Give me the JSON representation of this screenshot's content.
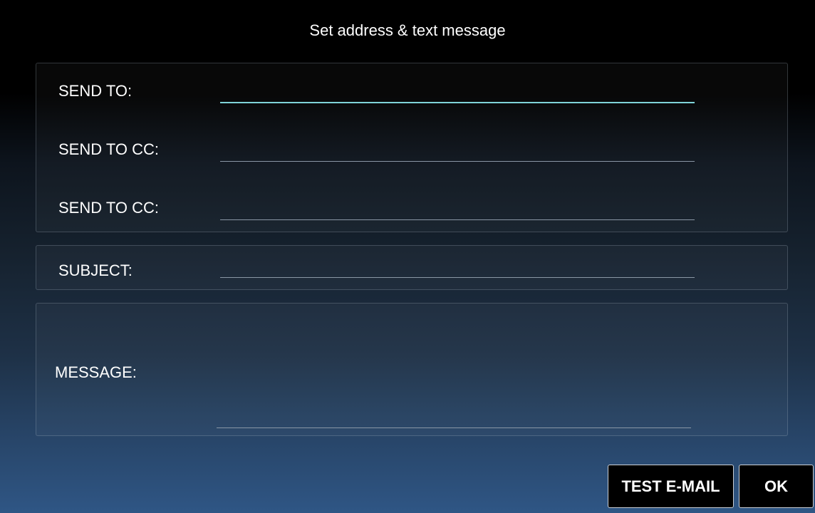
{
  "dialog": {
    "title": "Set address & text message"
  },
  "addresses": {
    "send_to": {
      "label": "SEND TO:",
      "value": ""
    },
    "send_to_cc_1": {
      "label": "SEND TO CC:",
      "value": ""
    },
    "send_to_cc_2": {
      "label": "SEND TO CC:",
      "value": ""
    }
  },
  "subject": {
    "label": "SUBJECT:",
    "value": ""
  },
  "message": {
    "label": "MESSAGE:",
    "value": ""
  },
  "buttons": {
    "test_email": "TEST E-MAIL",
    "ok": "OK"
  },
  "colors": {
    "focus_underline": "#7fd3d8",
    "underline": "#8a97a5",
    "button_bg": "#000000",
    "gradient_bottom": "#2f5685"
  }
}
